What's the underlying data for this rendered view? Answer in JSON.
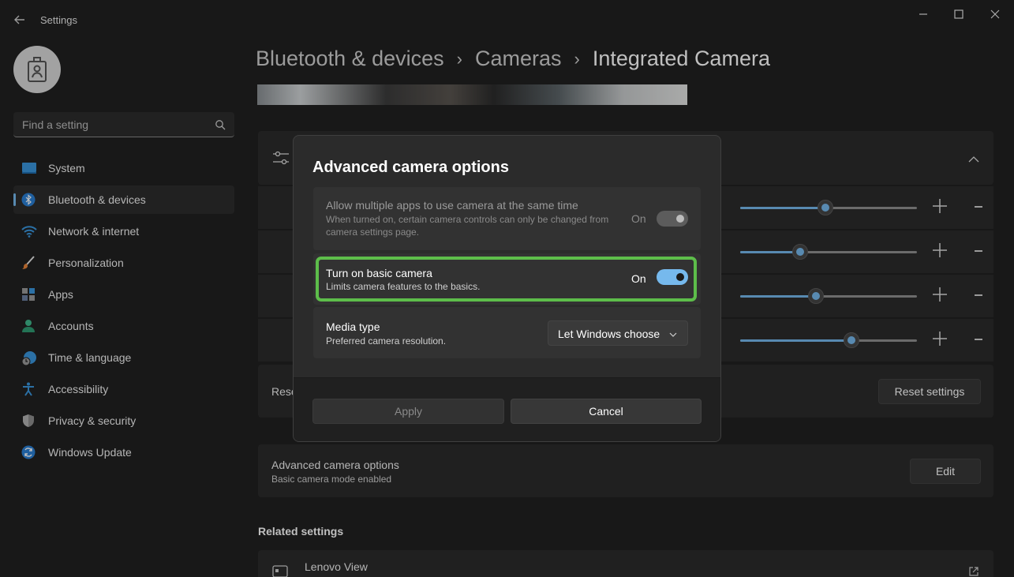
{
  "window": {
    "title": "Settings",
    "controls": [
      "minimize",
      "maximize",
      "close"
    ]
  },
  "sidebar": {
    "search_placeholder": "Find a setting",
    "items": [
      {
        "label": "System",
        "icon": "monitor-icon",
        "active": false
      },
      {
        "label": "Bluetooth & devices",
        "icon": "bluetooth-icon",
        "active": true
      },
      {
        "label": "Network & internet",
        "icon": "wifi-icon",
        "active": false
      },
      {
        "label": "Personalization",
        "icon": "brush-icon",
        "active": false
      },
      {
        "label": "Apps",
        "icon": "apps-icon",
        "active": false
      },
      {
        "label": "Accounts",
        "icon": "person-icon",
        "active": false
      },
      {
        "label": "Time & language",
        "icon": "globe-clock-icon",
        "active": false
      },
      {
        "label": "Accessibility",
        "icon": "accessibility-icon",
        "active": false
      },
      {
        "label": "Privacy & security",
        "icon": "shield-icon",
        "active": false
      },
      {
        "label": "Windows Update",
        "icon": "update-icon",
        "active": false
      }
    ]
  },
  "breadcrumb": {
    "parts": [
      "Bluetooth & devices",
      "Cameras"
    ],
    "current": "Integrated Camera",
    "separator": "›"
  },
  "sliders": {
    "levels": [
      0.48,
      0.34,
      0.43,
      0.63
    ],
    "accent": "#76b9ed"
  },
  "reset_row": {
    "label_partial": "Rese",
    "button": "Reset settings"
  },
  "advanced_row": {
    "title": "Advanced camera options",
    "subtitle": "Basic camera mode enabled",
    "button": "Edit"
  },
  "related": {
    "title": "Related settings",
    "items": [
      {
        "label": "Lenovo View"
      }
    ]
  },
  "dialog": {
    "title": "Advanced camera options",
    "rows": {
      "multi_app": {
        "title": "Allow multiple apps to use camera at the same time",
        "description": "When turned on, certain camera controls can only be changed from camera settings page.",
        "state_label": "On",
        "enabled": false
      },
      "basic_camera": {
        "title": "Turn on basic camera",
        "description": "Limits camera features to the basics.",
        "state_label": "On",
        "enabled": true
      },
      "media_type": {
        "title": "Media type",
        "description": "Preferred camera resolution.",
        "selected": "Let Windows choose"
      }
    },
    "apply": "Apply",
    "cancel": "Cancel",
    "highlight_color": "#5dbd4a"
  }
}
